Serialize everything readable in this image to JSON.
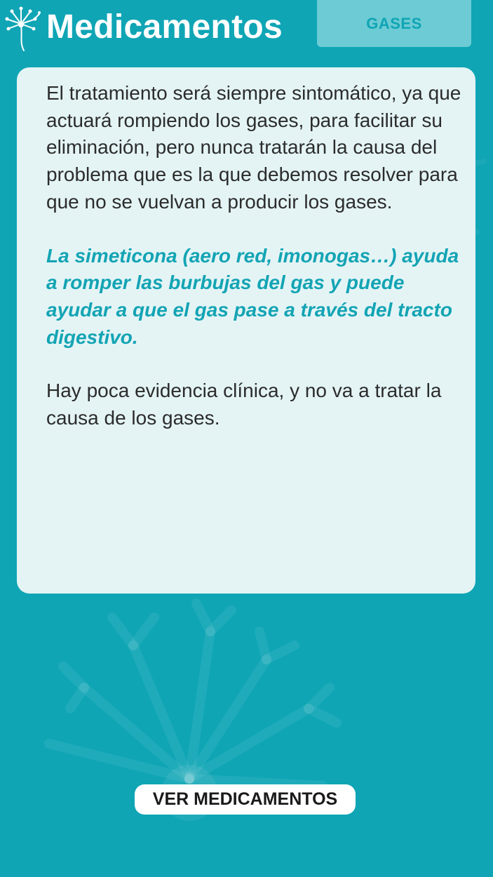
{
  "header": {
    "app_title": "Medicamentos",
    "section_tab": "GASES",
    "logo_icon": "dandelion-icon"
  },
  "content": {
    "paragraph_1": "El tratamiento será siempre sintomático, ya que actuará rompiendo los gases, para facilitar su eliminación, pero nunca tratarán la causa del problema que es la que debemos resolver para que no se vuelvan a producir los gases.",
    "paragraph_highlight": "La simeticona (aero red, imonogas…) ayuda a romper las burbujas del gas y puede ayudar a que el gas pase a través del tracto digestivo.",
    "paragraph_3": "Hay poca evidencia clínica, y no va a tratar la causa de los gases."
  },
  "footer": {
    "cta_label": "VER MEDICAMENTOS"
  },
  "colors": {
    "background": "#0fa5b5",
    "tab": "#6ccbd4",
    "card": "#e4f4f5",
    "highlight_text": "#13a4b4",
    "body_text": "#2c2c2c"
  }
}
